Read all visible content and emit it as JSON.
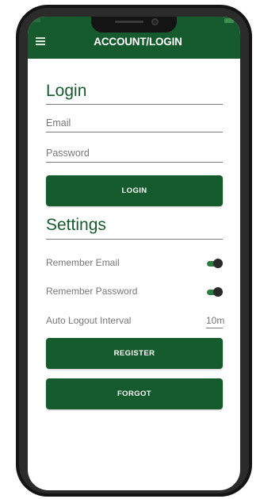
{
  "app": {
    "title": "ACCOUNT/LOGIN"
  },
  "icons": {
    "menu": "hamburger-menu-icon"
  },
  "colors": {
    "primary": "#165b2d",
    "toggle_on": "#2e7a45"
  },
  "login": {
    "title": "Login",
    "email_placeholder": "Email",
    "email_value": "",
    "password_placeholder": "Password",
    "password_value": "",
    "login_label": "LOGIN"
  },
  "settings": {
    "title": "Settings",
    "remember_email_label": "Remember Email",
    "remember_email_on": true,
    "remember_password_label": "Remember Password",
    "remember_password_on": true,
    "auto_logout_label": "Auto Logout Interval",
    "auto_logout_value": "10m"
  },
  "actions": {
    "register_label": "REGISTER",
    "forgot_label": "FORGOT"
  }
}
